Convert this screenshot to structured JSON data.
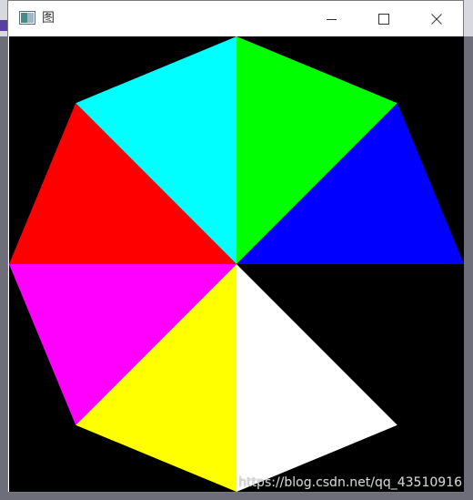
{
  "window": {
    "title": "图"
  },
  "controls": {
    "minimize_icon": "minimize-icon",
    "maximize_icon": "maximize-icon",
    "close_icon": "close-icon"
  },
  "octagon": {
    "background": "#000000",
    "segments": [
      {
        "name": "segment-cyan",
        "color": "#00ffff"
      },
      {
        "name": "segment-green",
        "color": "#00ff00"
      },
      {
        "name": "segment-blue",
        "color": "#0000ff"
      },
      {
        "name": "segment-black",
        "color": "#000000"
      },
      {
        "name": "segment-white",
        "color": "#ffffff"
      },
      {
        "name": "segment-yellow",
        "color": "#ffff00"
      },
      {
        "name": "segment-magenta",
        "color": "#ff00ff"
      },
      {
        "name": "segment-red",
        "color": "#ff0000"
      }
    ]
  },
  "watermark": "https://blog.csdn.net/qq_43510916"
}
